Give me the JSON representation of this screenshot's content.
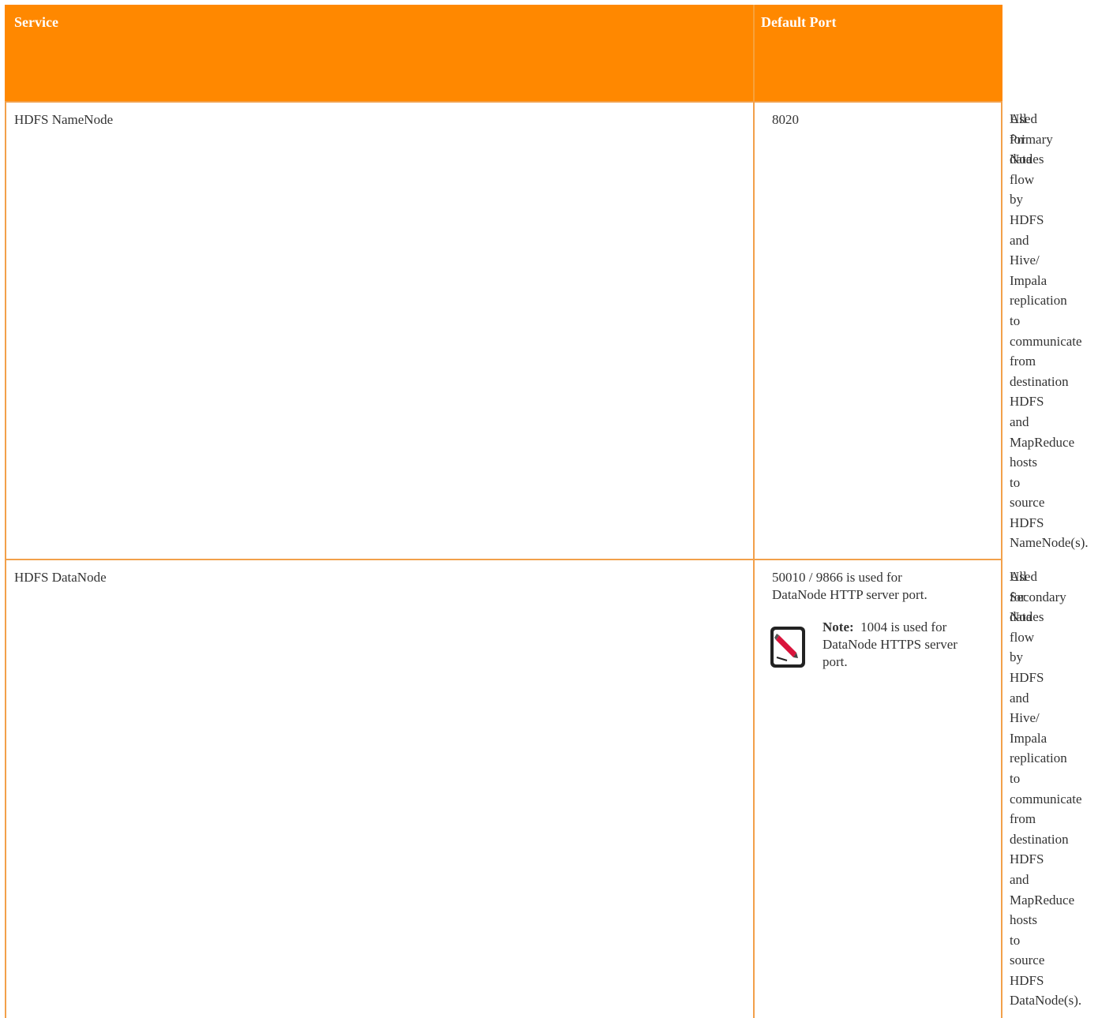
{
  "table": {
    "headers": {
      "service": "Service",
      "default_port": "Default Port"
    },
    "rows": [
      {
        "service": "HDFS NameNode",
        "port": "8020",
        "desc_overlay": [
          "All",
          "Primary",
          "Nodes"
        ],
        "desc_hidden_words": [
          "Used",
          "for",
          "data"
        ],
        "description": "flow\nby\nHDFS\nand\nHive/\nImpala\nreplication\nto\ncommunicate\nfrom\ndestination\nHDFS\nand\nMapReduce\nhosts\nto\nsource\nHDFS\nNameNode(s)."
      },
      {
        "service": "HDFS DataNode",
        "port": "50010 / 9866 is used for DataNode HTTP server port.",
        "note_label": "Note:",
        "note_text": "1004 is used for DataNode HTTPS server port.",
        "desc_overlay": [
          "All",
          "Secondary",
          "Nodes"
        ],
        "desc_hidden_words": [
          "Used",
          "for",
          "data"
        ],
        "description": "flow\nby\nHDFS\nand\nHive/\nImpala\nreplication\nto\ncommunicate\nfrom\ndestination\nHDFS\nand\nMapReduce\nhosts\nto\nsource\nHDFS\nDataNode(s)."
      }
    ]
  },
  "colors": {
    "header_bg": "#ff8800",
    "header_text": "#ffffff",
    "border": "#f2a04a",
    "body_text": "#333333"
  },
  "icons": {
    "note": "pencil-note-icon"
  }
}
